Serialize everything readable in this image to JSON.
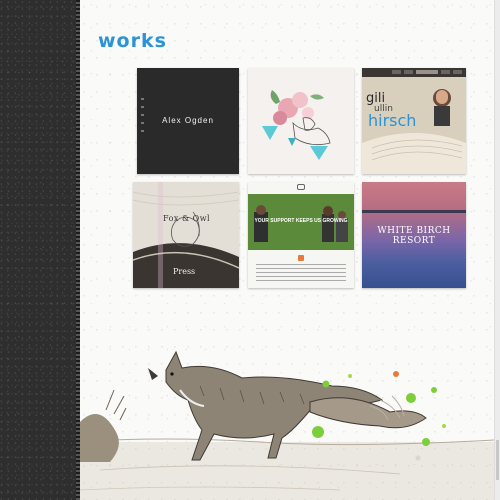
{
  "page": {
    "title": "works"
  },
  "colors": {
    "accent": "#2b93d6",
    "sidebar": "#2e2e2e"
  },
  "works": [
    {
      "label": "Alex Ogden"
    },
    {
      "label": ""
    },
    {
      "label_line1": "gili",
      "label_line2": "ullin",
      "label_line3": "hirsch"
    },
    {
      "label": "Fox & Owl",
      "label_bottom": "Press"
    },
    {
      "banner": "YOUR SUPPORT KEEPS US GROWING"
    },
    {
      "label": "WHITE BIRCH RESORT"
    }
  ],
  "decor": {
    "illustration": "fox-illustration"
  }
}
